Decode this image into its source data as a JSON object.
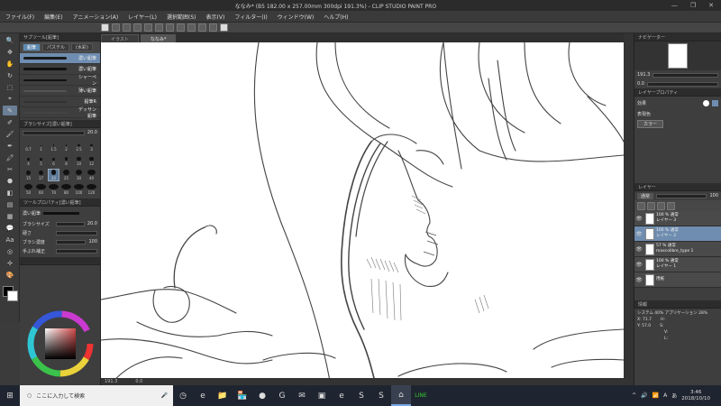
{
  "window": {
    "title": "ななみ* (B5 182.00 x 257.00mm 300dpi 191.3%) - CLIP STUDIO PAINT PRO",
    "controls": [
      "—",
      "❐",
      "✕"
    ]
  },
  "menu": [
    "ファイル(F)",
    "編集(E)",
    "アニメーション(A)",
    "レイヤー(L)",
    "選択範囲(S)",
    "表示(V)",
    "フィルター(I)",
    "ウィンドウ(W)",
    "ヘルプ(H)"
  ],
  "canvas_tabs": [
    {
      "label": "イラスト"
    },
    {
      "label": "ななみ*"
    }
  ],
  "sub_tool": {
    "header": "サブツール[鉛筆]",
    "tabs": [
      "鉛筆",
      "パステル",
      "(水彩)"
    ],
    "brushes": [
      "濃い鉛筆",
      "濃い鉛筆",
      "シャーペン",
      "薄い鉛筆",
      "鉛筆R",
      "デッサン鉛筆"
    ]
  },
  "brush_size_palette": {
    "header": "ブラシサイズ[濃い鉛筆]",
    "value": "20.0",
    "sizes": [
      "0.7",
      "1",
      "1.5",
      "2",
      "2.5",
      "3",
      "4",
      "5",
      "6",
      "8",
      "10",
      "12",
      "15",
      "17",
      "20",
      "25",
      "30",
      "40",
      "50",
      "60",
      "70",
      "80",
      "100",
      "120"
    ]
  },
  "tool_property": {
    "header": "ツールプロパティ[濃い鉛筆]",
    "brush_name": "濃い鉛筆",
    "rows": [
      {
        "label": "ブラシサイズ",
        "value": "20.0"
      },
      {
        "label": "硬さ",
        "value": ""
      },
      {
        "label": "ブラシ濃度",
        "value": "100"
      },
      {
        "label": "手ぶれ補正",
        "value": ""
      }
    ]
  },
  "color_wheel": {
    "hue": "#d14a4a",
    "main": "#000000",
    "sub": "#ffffff",
    "icons": [
      "□",
      "◆",
      "△"
    ],
    "swatches": [
      "#c0392b",
      "#e67e22",
      "#f1c40f",
      "#27ae60",
      "#2980b9",
      "#8e44ad",
      "#888888",
      "#ffffff"
    ]
  },
  "navigator": {
    "header": "ナビゲーター",
    "zoom": "191.3",
    "angle": "0.0"
  },
  "layer_property": {
    "header": "レイヤープロパティ",
    "effect": "効果",
    "expression_color_label": "表現色",
    "expression_color": "カラー"
  },
  "layers": {
    "header": "レイヤー",
    "blend": "通常",
    "opacity": "100",
    "items": [
      {
        "line1": "100 % 通常",
        "line2": "レイヤー 3"
      },
      {
        "line1": "100 % 通常",
        "line2": "レイヤー 2"
      },
      {
        "line1": "57 % 通常",
        "line2": "maxcolibre_type 1"
      },
      {
        "line1": "100 % 通常",
        "line2": "レイヤー 1"
      },
      {
        "line1": "",
        "line2": "用紙"
      }
    ]
  },
  "info_panel": {
    "header": "情報",
    "system": "システム 40%",
    "application": "アプリケーション 28%",
    "x": "X: 71.7",
    "y": "Y: 57.0",
    "h": "H:",
    "s": "S:",
    "v": "V:",
    "l": "L:"
  },
  "status_bar": {
    "zoom": "191.3",
    "angle": "0.0"
  },
  "tools": [
    "🔍",
    "✥",
    "✋",
    "↻",
    "⬚",
    "⌖",
    "✎",
    "✐",
    "🖌",
    "✒",
    "🖍",
    "✂",
    "⬣",
    "◧",
    "▤",
    "▦",
    "💬",
    "Aa",
    "◎",
    "✢",
    "🎨"
  ],
  "taskbar": {
    "search_placeholder": "ここに入力して検索",
    "time": "3:46",
    "date": "2018/10/10",
    "apps": [
      "⊞",
      "◷",
      "e",
      "📁",
      "🏪",
      "●",
      "G",
      "✉",
      "▣",
      "e",
      "S",
      "S",
      "⌂",
      "LINE"
    ],
    "tray": [
      "^",
      "🔊",
      "📶",
      "A",
      "あ"
    ]
  }
}
